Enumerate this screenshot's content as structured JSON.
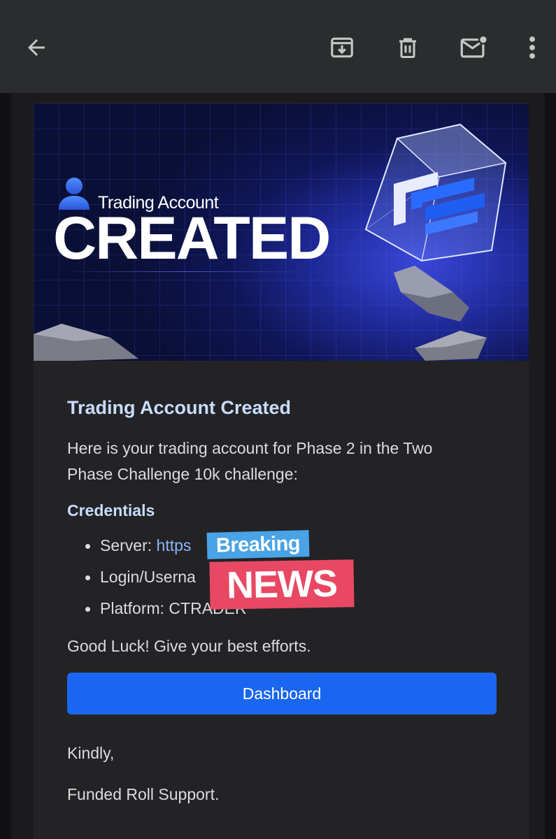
{
  "toolbar": {
    "back_icon": "arrow-left-icon",
    "archive_icon": "archive-icon",
    "delete_icon": "trash-icon",
    "mark_unread_icon": "mail-unread-icon",
    "more_icon": "more-vertical-icon"
  },
  "hero": {
    "subtitle": "Trading Account",
    "title": "CREATED",
    "user_icon": "user-icon",
    "logo_icon": "glass-cube-logo-icon"
  },
  "email": {
    "heading": "Trading Account Created",
    "intro_line1": "Here is your trading account for Phase 2 in the Two",
    "intro_line2": "Phase Challenge 10k challenge:",
    "credentials_title": "Credentials",
    "credentials": [
      {
        "label": "Server: ",
        "value": "https://tradelocker.com",
        "visible_value": "https"
      },
      {
        "label": "Login/Userna",
        "value": ""
      },
      {
        "label": "Platform: ",
        "value": "CTRADER"
      }
    ],
    "good_luck": "Good Luck! Give your best efforts.",
    "dashboard_button": "Dashboard",
    "signoff": "Kindly,",
    "signature": "Funded Roll Support."
  },
  "sticker": {
    "top": "Breaking",
    "bottom": "NEWS"
  },
  "colors": {
    "toolbar_bg": "#2b2c2e",
    "page_bg": "#1b1b1d",
    "card_bg": "#232325",
    "heading": "#c8dcff",
    "link": "#8ab4f8",
    "button": "#1a66f0",
    "sticker_top": "#49a3e6",
    "sticker_bottom": "#e84863"
  }
}
